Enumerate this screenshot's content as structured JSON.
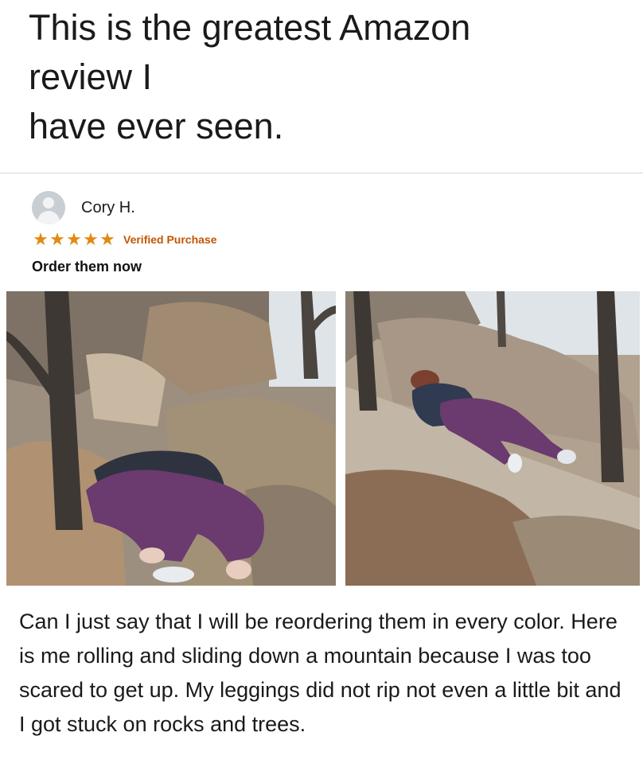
{
  "headline": {
    "line1": "This is the greatest Amazon",
    "line2": "review I",
    "line3": "have ever seen."
  },
  "review": {
    "reviewer_name": "Cory H.",
    "avatar_icon": "user-avatar-icon",
    "rating": 5,
    "rating_max": 5,
    "star_icon": "star-icon",
    "star_color": "#e08a16",
    "badge": "Verified Purchase",
    "badge_color": "#c45500",
    "title": "Order them now",
    "body": "Can I just say that I will be reordering them in every color. Here is me rolling and sliding down a mountain because I was too scared to get up. My leggings did not rip not even a little bit and I got stuck on rocks and trees."
  },
  "photos": [
    {
      "name": "review-photo-left"
    },
    {
      "name": "review-photo-right"
    }
  ],
  "colors": {
    "leggings": "#6b3a6e",
    "rock": "#a8927a",
    "sky": "#dfe4e8"
  }
}
